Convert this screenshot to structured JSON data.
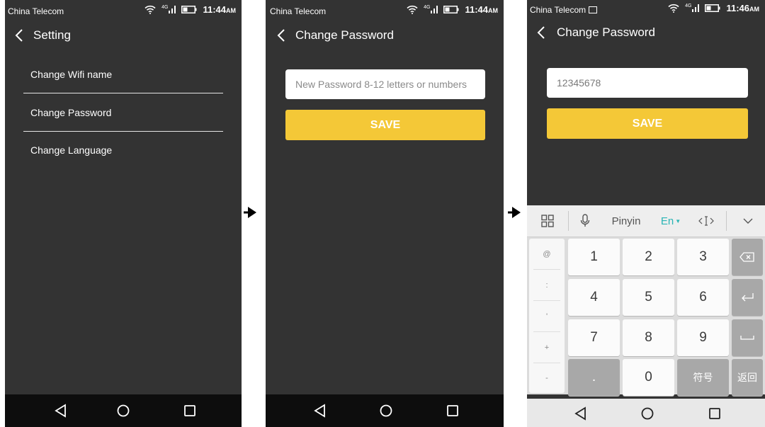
{
  "colors": {
    "screen_bg": "#333333",
    "accent_yellow": "#f4c837",
    "nav_bar": "#0d0d0d",
    "keyboard_bg": "#dcdcdc",
    "en_accent": "#2bb5b5"
  },
  "screen1": {
    "status": {
      "carrier": "China Telecom",
      "network": "4G",
      "time": "11:44",
      "ampm": "AM"
    },
    "title": "Setting",
    "menu": [
      "Change Wifi name",
      "Change Password",
      "Change Language"
    ]
  },
  "screen2": {
    "status": {
      "carrier": "China Telecom",
      "network": "4G",
      "time": "11:44",
      "ampm": "AM"
    },
    "title": "Change Password",
    "password_placeholder": "New Password 8-12 letters or numbers",
    "password_value": "",
    "save_label": "SAVE"
  },
  "screen3": {
    "status": {
      "carrier": "China Telecom",
      "network": "4G",
      "time": "11:46",
      "ampm": "AM"
    },
    "title": "Change Password",
    "password_value": "12345678",
    "save_label": "SAVE",
    "keyboard": {
      "toolbar": {
        "pinyin": "Pinyin",
        "lang": "En"
      },
      "side_keys": [
        "@",
        ":",
        "'",
        "+",
        "-"
      ],
      "digits": [
        "1",
        "2",
        "3",
        "4",
        "5",
        "6",
        "7",
        "8",
        "9",
        "0"
      ],
      "dot": ".",
      "symbols_label": "符号",
      "return_label": "返回"
    }
  },
  "icons": {
    "back": "chevron-left-icon",
    "wifi": "wifi-icon",
    "signal": "signal-icon",
    "battery": "battery-icon",
    "nav_back": "triangle-back-icon",
    "nav_home": "circle-home-icon",
    "nav_recent": "square-recent-icon",
    "grid": "grid-icon",
    "mic": "mic-icon",
    "cursor": "cursor-icon",
    "collapse": "chevron-down-icon",
    "backspace": "backspace-icon",
    "enter": "enter-icon",
    "space": "space-icon",
    "flow_arrow": "right-arrow-icon"
  }
}
